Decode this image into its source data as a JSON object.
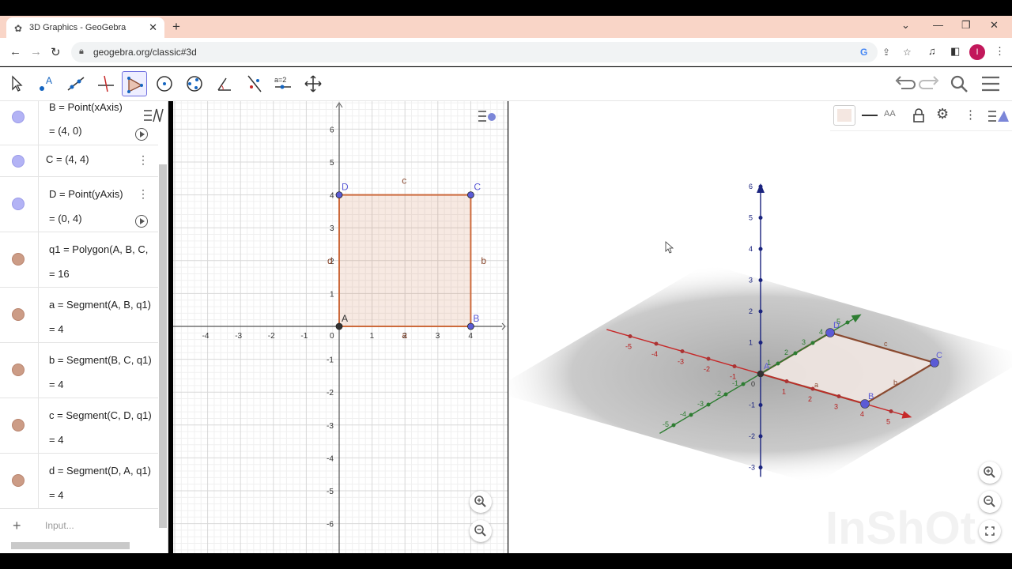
{
  "browser": {
    "tab_title": "3D Graphics - GeoGebra",
    "new_tab": "+",
    "url": "geogebra.org/classic#3d",
    "profile_initial": "I"
  },
  "toolbar": {
    "tools": [
      "move-tool",
      "point-tool",
      "line-tool",
      "perpendicular-tool",
      "polygon-tool",
      "circle-tool",
      "conic-tool",
      "angle-tool",
      "reflect-tool",
      "slider-tool",
      "move-view-tool"
    ],
    "active_tool": "polygon-tool",
    "slider_label": "a=2"
  },
  "algebra": {
    "rows": [
      {
        "def": "B = Point(xAxis)",
        "val": "= (4, 0)",
        "color": "#b3b3f5"
      },
      {
        "def": "C = (4, 4)",
        "val": "",
        "color": "#b3b3f5"
      },
      {
        "def": "D = Point(yAxis)",
        "val": "= (0, 4)",
        "color": "#b3b3f5"
      },
      {
        "def": "q1 = Polygon(A, B, C,",
        "val": "= 16",
        "color": "#cc9c86"
      },
      {
        "def": "a = Segment(A, B, q1)",
        "val": "= 4",
        "color": "#cc9c86"
      },
      {
        "def": "b = Segment(B, C, q1)",
        "val": "= 4",
        "color": "#cc9c86"
      },
      {
        "def": "c = Segment(C, D, q1)",
        "val": "= 4",
        "color": "#cc9c86"
      },
      {
        "def": "d = Segment(D, A, q1)",
        "val": "= 4",
        "color": "#cc9c86"
      }
    ],
    "input_placeholder": "Input..."
  },
  "graphics2d": {
    "x_ticks": [
      "-4",
      "-3",
      "-2",
      "-1",
      "0",
      "1",
      "2",
      "3",
      "4"
    ],
    "y_ticks": [
      "6",
      "5",
      "4",
      "3",
      "2",
      "1",
      "-1",
      "-2",
      "-3",
      "-4",
      "-5",
      "-6"
    ],
    "points": {
      "A": "A",
      "B": "B",
      "C": "C",
      "D": "D"
    },
    "segments": {
      "a": "a",
      "b": "b",
      "c": "c",
      "d": "d"
    },
    "polygon_color": "#cc6a3c",
    "point_color": "#5b5bd6"
  },
  "graphics3d": {
    "z_ticks": [
      "6",
      "5",
      "4",
      "3",
      "2",
      "1",
      "-1",
      "-2",
      "-3"
    ],
    "x_ticks": [
      "-5",
      "-4",
      "-3",
      "-2",
      "-1",
      "1",
      "2",
      "3",
      "4",
      "5"
    ],
    "y_ticks": [
      "-5",
      "-4",
      "-3",
      "-2",
      "-1",
      "1",
      "2",
      "3",
      "4",
      "5"
    ],
    "origin": "0",
    "points": [
      "A",
      "B",
      "C",
      "D"
    ],
    "segment_labels": [
      "a",
      "b",
      "c"
    ],
    "watermark": "InShOt"
  },
  "colors": {
    "accent": "#6557d2",
    "tab_strip": "#f9d5c7",
    "x_axis_3d": "#c62828",
    "y_axis_3d": "#2e7d32",
    "z_axis_3d": "#1a237e"
  }
}
